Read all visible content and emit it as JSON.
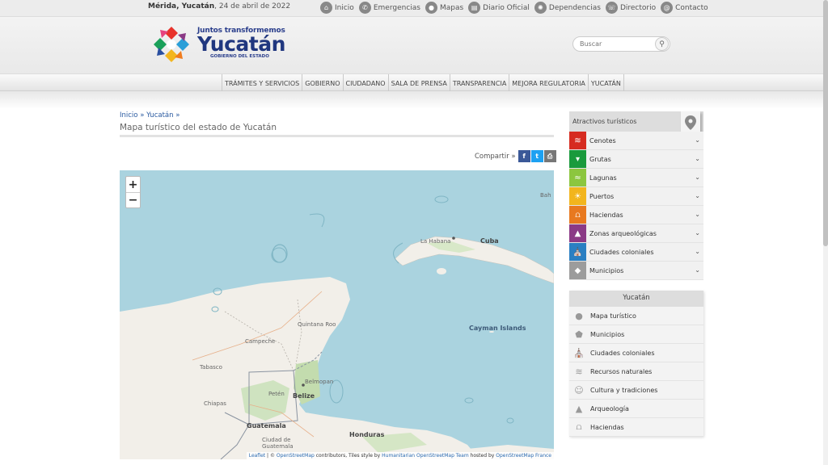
{
  "topbar": {
    "date_place": "Mérida, Yucatán",
    "date_rest": ", 24 de abril de 2022",
    "links": [
      {
        "label": "Inicio",
        "icon": "home-icon"
      },
      {
        "label": "Emergencias",
        "icon": "phone-icon"
      },
      {
        "label": "Mapas",
        "icon": "map-pin-icon"
      },
      {
        "label": "Diario Oficial",
        "icon": "newspaper-icon"
      },
      {
        "label": "Dependencias",
        "icon": "building-icon"
      },
      {
        "label": "Directorio",
        "icon": "contact-book-icon"
      },
      {
        "label": "Contacto",
        "icon": "at-icon"
      }
    ]
  },
  "header": {
    "logo_line1": "Juntos transformemos",
    "logo_line2": "Yucatán",
    "logo_line3": "GOBIERNO DEL ESTADO",
    "search_placeholder": "Buscar"
  },
  "nav": {
    "items": [
      "TRÁMITES Y SERVICIOS",
      "GOBIERNO",
      "CIUDADANO",
      "SALA DE PRENSA",
      "TRANSPARENCIA",
      "MEJORA REGULATORIA",
      "YUCATÁN"
    ]
  },
  "content": {
    "breadcrumb": "Inicio » Yucatán »",
    "title": "Mapa turístico del estado de Yucatán",
    "share_label": "Compartir »"
  },
  "map": {
    "zoom_in": "+",
    "zoom_out": "−",
    "labels": {
      "bahamas": "Bah",
      "la_habana": "La Habana",
      "cuba": "Cuba",
      "cayman": "Cayman Islands",
      "quintana_roo": "Quintana\nRoo",
      "campeche": "Campeche",
      "tabasco": "Tabasco",
      "chiapas": "Chiapas",
      "peten": "Petén",
      "belmopan": "Belmopan",
      "belize": "Belize",
      "guatemala": "Guatemala",
      "ciudad_guatemala": "Ciudad de\nGuatemala",
      "honduras": "Honduras"
    },
    "attribution": {
      "leaflet": "Leaflet",
      "sep": " | © ",
      "osm": "OpenStreetMap",
      "contrib": " contributors, Tiles style by ",
      "hot": "Humanitarian OpenStreetMap Team",
      "hosted": " hosted by ",
      "osmfr": "OpenStreetMap France"
    }
  },
  "attractions": {
    "title": "Atractivos turísticos",
    "items": [
      {
        "label": "Cenotes",
        "color": "#d62b20"
      },
      {
        "label": "Grutas",
        "color": "#1a9a3c"
      },
      {
        "label": "Lagunas",
        "color": "#8cc63f"
      },
      {
        "label": "Puertos",
        "color": "#f2b51d"
      },
      {
        "label": "Haciendas",
        "color": "#e8791f"
      },
      {
        "label": "Zonas arqueológicas",
        "color": "#8b3a86"
      },
      {
        "label": "Ciudades coloniales",
        "color": "#2a7fc2"
      },
      {
        "label": "Municipios",
        "color": "#9c9c9c"
      }
    ]
  },
  "yucatan_menu": {
    "title": "Yucatán",
    "items": [
      "Mapa turístico",
      "Municipios",
      "Ciudades coloniales",
      "Recursos naturales",
      "Cultura y tradiciones",
      "Arqueología",
      "Haciendas"
    ]
  }
}
